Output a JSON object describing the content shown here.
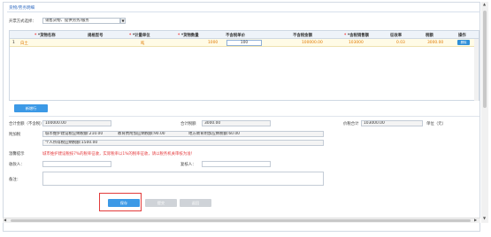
{
  "panel_title": "货物/劳务明细",
  "invoice_type": {
    "label": "开票方式选择：",
    "value": "销售货物、提供劳务/服务"
  },
  "table": {
    "columns": [
      "*货物名称",
      "规格型号",
      "*计量单位",
      "*货物数量",
      "不含税单价",
      "不含税金额",
      "*含税销售额",
      "征收率",
      "税额",
      "操作"
    ],
    "rows": [
      {
        "index": "1",
        "name": "白土",
        "spec": "",
        "unit": "吨",
        "quantity": "1000",
        "unit_price": "100",
        "amount": "100000.00",
        "tax_incl_amount": "103000",
        "rate": "0.03",
        "tax": "3000.00",
        "op": "删除"
      }
    ]
  },
  "add_row_button": "新增行",
  "summary": {
    "total_amount_label": "合计金额（不含税）",
    "total_amount": "100000.00",
    "total_tax_label": "合计税额",
    "total_tax": "3000.00",
    "grand_total_label": "价税合计",
    "grand_total": "103000.00",
    "unit_label": "单位（元）"
  },
  "surcharges": {
    "label": "附加税",
    "city_tax": "城市维护建设税应纳税额:210.00",
    "edu_fee": "教育费附加应纳税额:90.00",
    "local_edu_fee": "地方教育附加应纳税额:60.00",
    "stamp_tax": "个人所得税应纳税额:1500.00"
  },
  "notice": {
    "label": "温馨提示",
    "text": "城市维护建设税按7%的税率征收，实际税率以1%的税率征收，请以税务机关审核为准！"
  },
  "payee": {
    "label": "收款人：",
    "value": ""
  },
  "reviewer": {
    "label": "复核人：",
    "value": ""
  },
  "remarks": {
    "label": "备注：",
    "value": ""
  },
  "buttons": {
    "save": "保存",
    "submit": "提交",
    "back": "返回"
  }
}
